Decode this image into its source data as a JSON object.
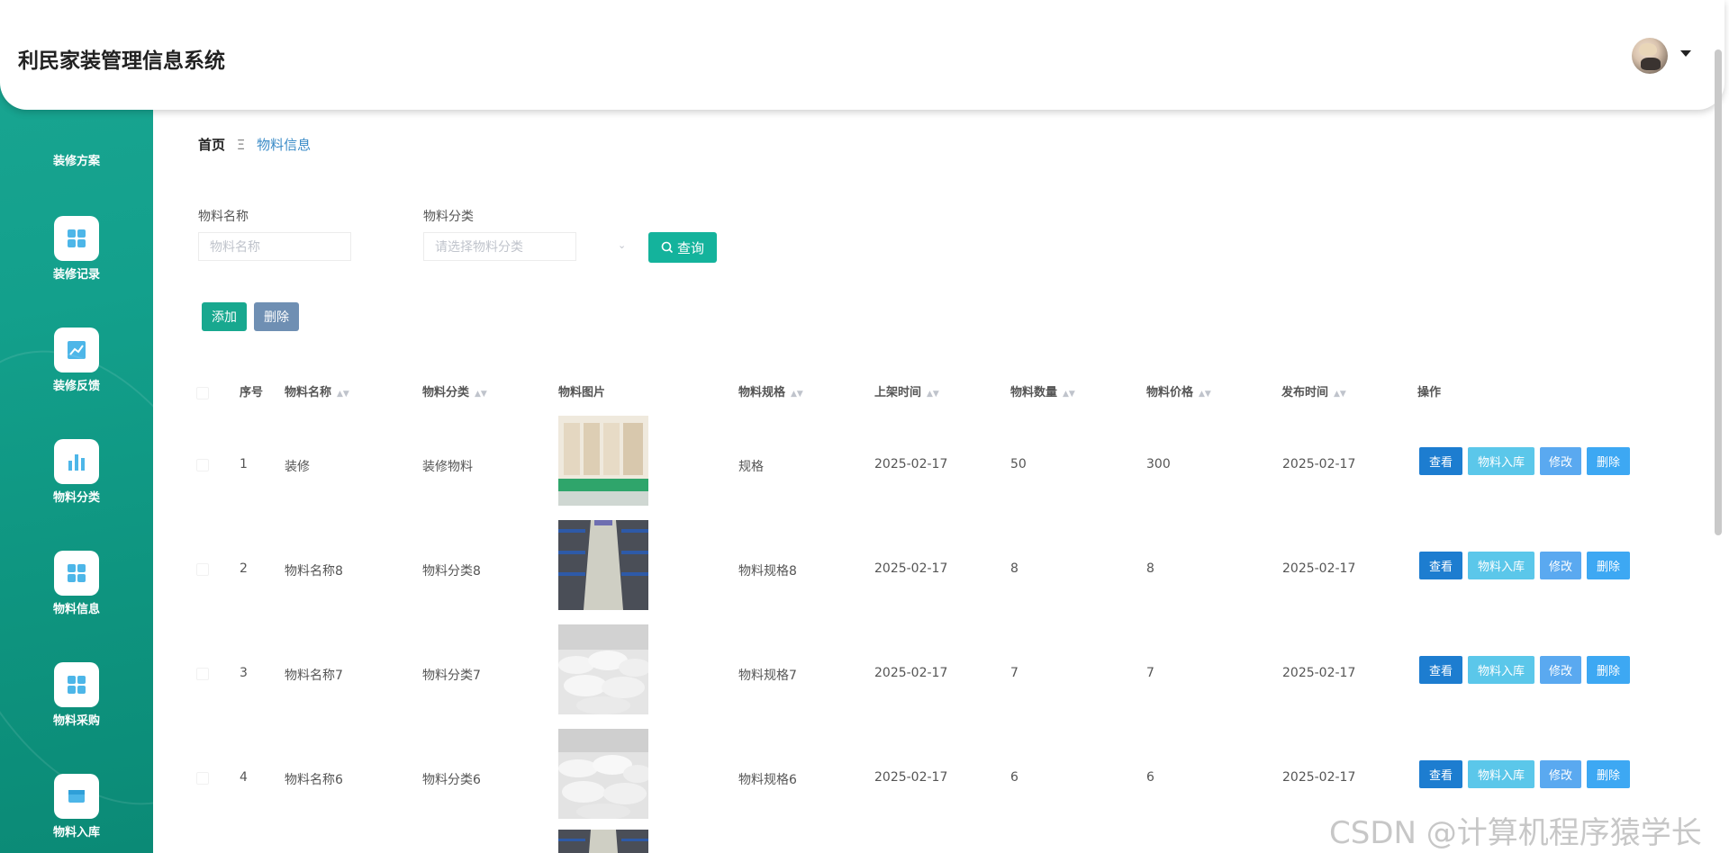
{
  "header": {
    "title": "利民家装管理信息系统"
  },
  "sidebar": {
    "items": [
      {
        "label": "装修方案",
        "icon": ""
      },
      {
        "label": "装修记录",
        "icon": "grid-icon"
      },
      {
        "label": "装修反馈",
        "icon": "line-chart-icon"
      },
      {
        "label": "物料分类",
        "icon": "bar-chart-icon"
      },
      {
        "label": "物料信息",
        "icon": "grid-icon"
      },
      {
        "label": "物料采购",
        "icon": "grid-icon"
      },
      {
        "label": "物料入库",
        "icon": "box-icon"
      }
    ]
  },
  "breadcrumb": {
    "home": "首页",
    "separator": "Ξ",
    "current": "物料信息"
  },
  "search": {
    "name_label": "物料名称",
    "name_placeholder": "物料名称",
    "category_label": "物料分类",
    "category_placeholder": "请选择物料分类",
    "search_button": "查询"
  },
  "toolbar": {
    "add_label": "添加",
    "delete_label": "删除"
  },
  "table": {
    "columns": [
      "序号",
      "物料名称",
      "物料分类",
      "物料图片",
      "物料规格",
      "上架时间",
      "物料数量",
      "物料价格",
      "发布时间",
      "操作"
    ],
    "rows": [
      {
        "index": "1",
        "name": "装修",
        "category": "装修物料",
        "spec": "规格",
        "shelf_date": "2025-02-17",
        "quantity": "50",
        "price": "300",
        "publish_date": "2025-02-17",
        "image": "warehouse-boxes"
      },
      {
        "index": "2",
        "name": "物料名称8",
        "category": "物料分类8",
        "spec": "物料规格8",
        "shelf_date": "2025-02-17",
        "quantity": "8",
        "price": "8",
        "publish_date": "2025-02-17",
        "image": "warehouse-shelves"
      },
      {
        "index": "3",
        "name": "物料名称7",
        "category": "物料分类7",
        "spec": "物料规格7",
        "shelf_date": "2025-02-17",
        "quantity": "7",
        "price": "7",
        "publish_date": "2025-02-17",
        "image": "sacks"
      },
      {
        "index": "4",
        "name": "物料名称6",
        "category": "物料分类6",
        "spec": "物料规格6",
        "shelf_date": "2025-02-17",
        "quantity": "6",
        "price": "6",
        "publish_date": "2025-02-17",
        "image": "sacks"
      }
    ],
    "actions": {
      "view": "查看",
      "stock_in": "物料入库",
      "edit": "修改",
      "delete": "删除"
    }
  },
  "watermark": "CSDN @计算机程序猿学长",
  "colors": {
    "primary": "#14b39c",
    "sidebar": "#13a08c",
    "link": "#3a8bc7"
  }
}
